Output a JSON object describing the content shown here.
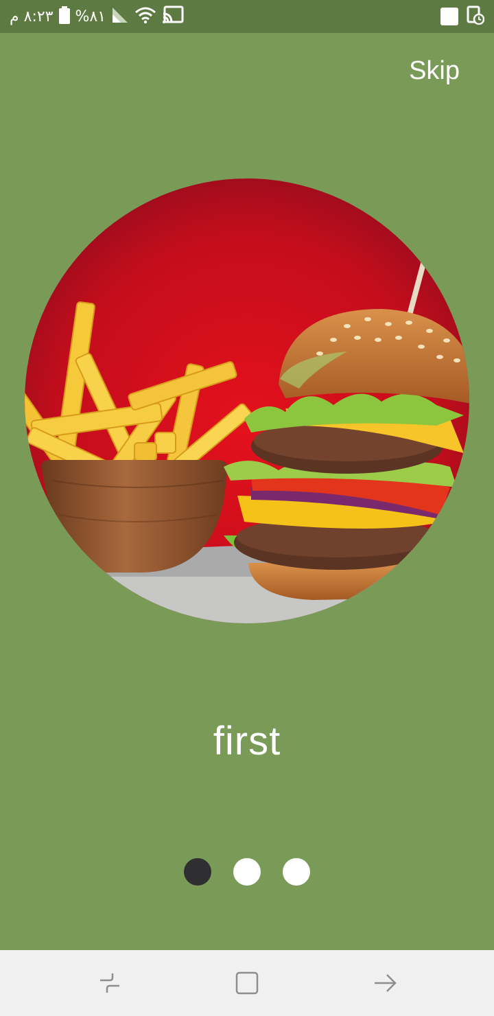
{
  "status_bar": {
    "time": "٨:٢٣ م",
    "battery_percent": "%٨١",
    "icons": [
      "battery-icon",
      "signal-icon",
      "wifi-icon",
      "cast-icon",
      "notification-square-icon",
      "screen-recorder-icon"
    ]
  },
  "onboarding": {
    "skip_label": "Skip",
    "slide_title": "first",
    "hero_image": "burger-and-fries-image",
    "pages": 3,
    "current_page": 1
  },
  "nav_bar": {
    "buttons": [
      "recents-icon",
      "home-icon",
      "back-icon"
    ]
  },
  "colors": {
    "background": "#799b57",
    "status_bar": "#5e7a43",
    "dot_active": "#2f2f31",
    "dot_inactive": "#ffffff",
    "nav_bar": "#f0f0f0"
  }
}
